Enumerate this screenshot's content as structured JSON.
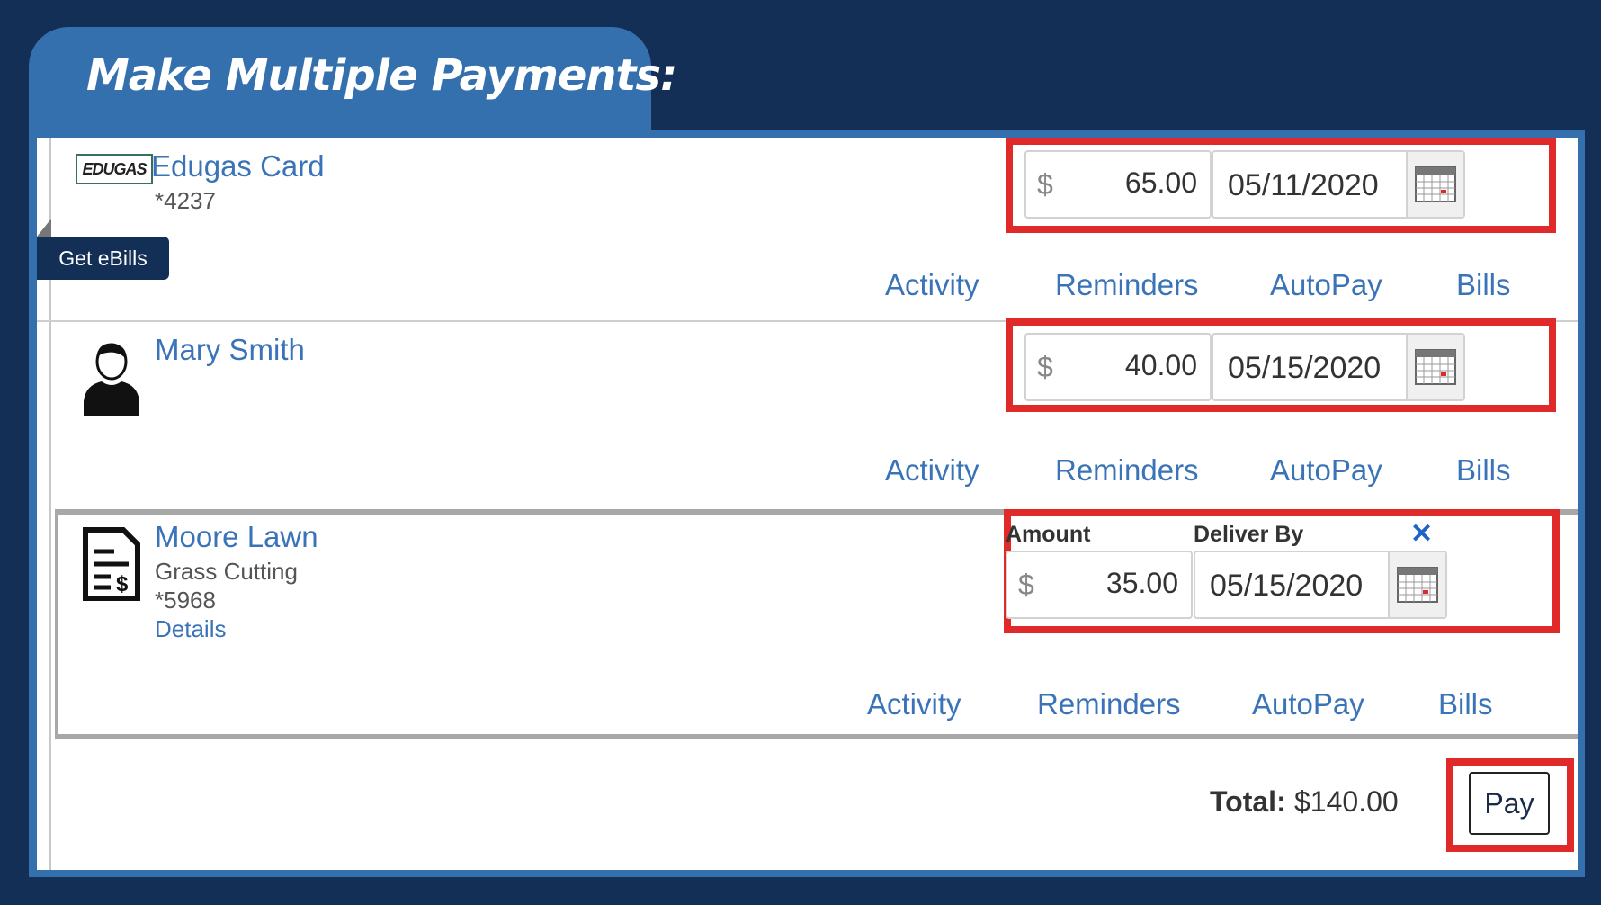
{
  "title": "Make Multiple Payments:",
  "get_ebills": "Get eBills",
  "actions": {
    "activity": "Activity",
    "reminders": "Reminders",
    "autopay": "AutoPay",
    "bills": "Bills"
  },
  "currency_symbol": "$",
  "payees": [
    {
      "logo_text": "EDUGAS",
      "name": "Edugas Card",
      "account": "*4237",
      "amount": "65.00",
      "date": "05/11/2020"
    },
    {
      "name": "Mary Smith",
      "icon": "person-icon",
      "amount": "40.00",
      "date": "05/15/2020"
    },
    {
      "name": "Moore Lawn",
      "icon": "bill-document-icon",
      "category": "Grass Cutting",
      "account": "*5968",
      "details": "Details",
      "amount_label": "Amount",
      "deliver_label": "Deliver By",
      "amount": "35.00",
      "date": "05/15/2020",
      "close_symbol": "✕"
    }
  ],
  "total": {
    "label": "Total:",
    "value": "$140.00"
  },
  "pay_button": "Pay",
  "colors": {
    "background": "#132f55",
    "frame": "#3370ad",
    "highlight": "#e02a2a",
    "link": "#3a73b8"
  }
}
